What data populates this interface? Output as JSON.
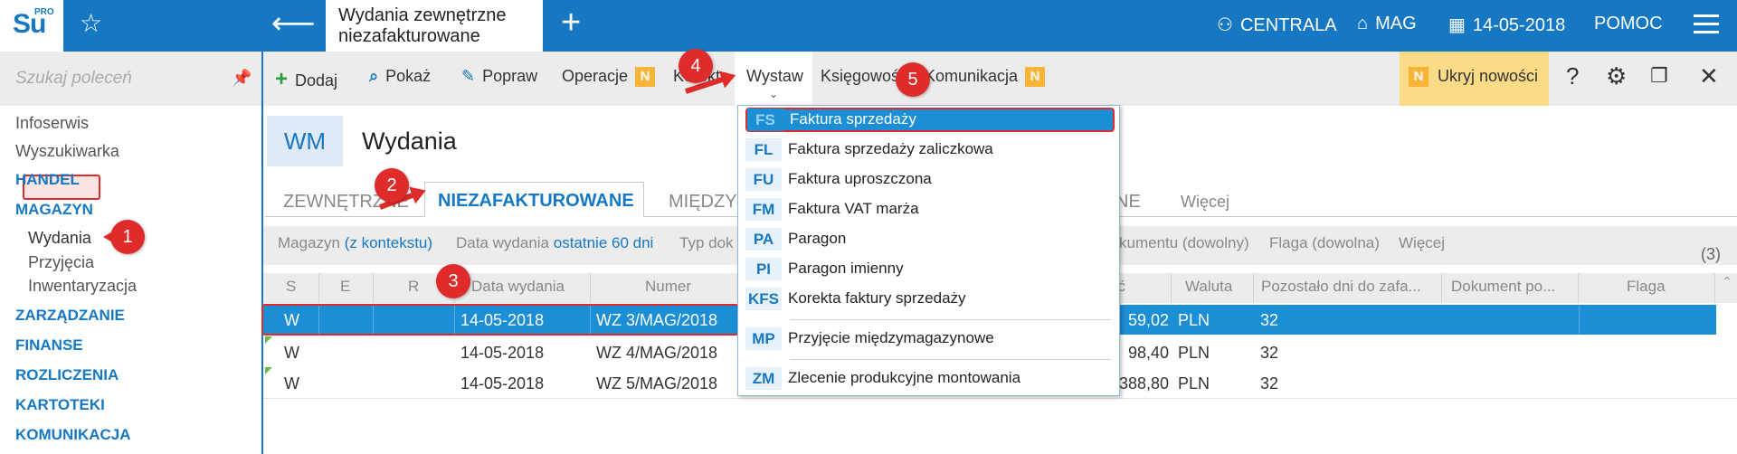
{
  "app": {
    "logo_text": "Su",
    "logo_sup": "PRO",
    "tab_title_line1": "Wydania zewnętrzne",
    "tab_title_line2": "niezafakturowane",
    "accent_color": "#1678c2",
    "highlight_color": "#e02b2b"
  },
  "topbar": {
    "centrala": "CENTRALA",
    "mag": "MAG",
    "date": "14-05-2018",
    "pomoc": "POMOC"
  },
  "sidebar": {
    "search_placeholder": "Szukaj poleceń",
    "items": [
      {
        "label": "Infoserwis",
        "kind": "plain"
      },
      {
        "label": "Wyszukiwarka",
        "kind": "plain"
      },
      {
        "label": "HANDEL",
        "kind": "section"
      },
      {
        "label": "MAGAZYN",
        "kind": "section"
      },
      {
        "label": "Wydania",
        "kind": "sub"
      },
      {
        "label": "Przyjęcia",
        "kind": "sub"
      },
      {
        "label": "Inwentaryzacja",
        "kind": "sub"
      },
      {
        "label": "ZARZĄDZANIE",
        "kind": "section"
      },
      {
        "label": "FINANSE",
        "kind": "section"
      },
      {
        "label": "ROZLICZENIA",
        "kind": "section"
      },
      {
        "label": "KARTOTEKI",
        "kind": "section"
      },
      {
        "label": "KOMUNIKACJA",
        "kind": "section"
      }
    ]
  },
  "toolbar": {
    "dodaj": "Dodaj",
    "pokaz": "Pokaż",
    "popraw": "Popraw",
    "operacje": "Operacje",
    "korekta": "Korekta",
    "wystaw": "Wystaw",
    "ksiegowosc": "Księgowość",
    "komunikacja": "Komunikacja",
    "badge": "N",
    "ukryj": "Ukryj nowości"
  },
  "page": {
    "badge": "WM",
    "title": "Wydania"
  },
  "tabs": {
    "t1": "ZEWNĘTRZNE",
    "t2": "NIEZAFAKTUROWANE",
    "t3": "MIĘDZY",
    "t4": "NE",
    "more": "Więcej"
  },
  "filters": {
    "magazyn": "Magazyn",
    "magazyn_val": "(z kontekstu)",
    "data": "Data wydania",
    "data_val": "ostatnie 60 dni",
    "typ": "Typ dok",
    "dokument": "kumentu (dowolny)",
    "flaga": "Flaga (dowolna)",
    "wiecej": "Więcej",
    "count": "(3)"
  },
  "grid": {
    "headers": {
      "s": "S",
      "e": "E",
      "r": "R",
      "data": "Data wydania",
      "numer": "Numer",
      "wartosc": "ść",
      "waluta": "Waluta",
      "pozostalo": "Pozostało dni do zafa...",
      "dokument": "Dokument po...",
      "flaga": "Flaga"
    },
    "rows": [
      {
        "s": "W",
        "data": "14-05-2018",
        "numer": "WZ 3/MAG/2018",
        "wartosc": "59,02",
        "waluta": "PLN",
        "pozostalo": "32"
      },
      {
        "s": "W",
        "data": "14-05-2018",
        "numer": "WZ 4/MAG/2018",
        "wartosc": "98,40",
        "waluta": "PLN",
        "pozostalo": "32"
      },
      {
        "s": "W",
        "data": "14-05-2018",
        "numer": "WZ 5/MAG/2018",
        "wartosc": "388,80",
        "waluta": "PLN",
        "pozostalo": "32"
      }
    ]
  },
  "dropdown": [
    {
      "code": "FS",
      "label": "Faktura sprzedaży"
    },
    {
      "code": "FL",
      "label": "Faktura sprzedaży zaliczkowa"
    },
    {
      "code": "FU",
      "label": "Faktura uproszczona"
    },
    {
      "code": "FM",
      "label": "Faktura VAT marża"
    },
    {
      "code": "PA",
      "label": "Paragon"
    },
    {
      "code": "PI",
      "label": "Paragon imienny"
    },
    {
      "code": "KFS",
      "label": "Korekta faktury sprzedaży"
    },
    {
      "code": "MP",
      "label": "Przyjęcie międzymagazynowe"
    },
    {
      "code": "ZM",
      "label": "Zlecenie produkcyjne montowania"
    }
  ],
  "callouts": {
    "c1": "1",
    "c2": "2",
    "c3": "3",
    "c4": "4",
    "c5": "5"
  }
}
